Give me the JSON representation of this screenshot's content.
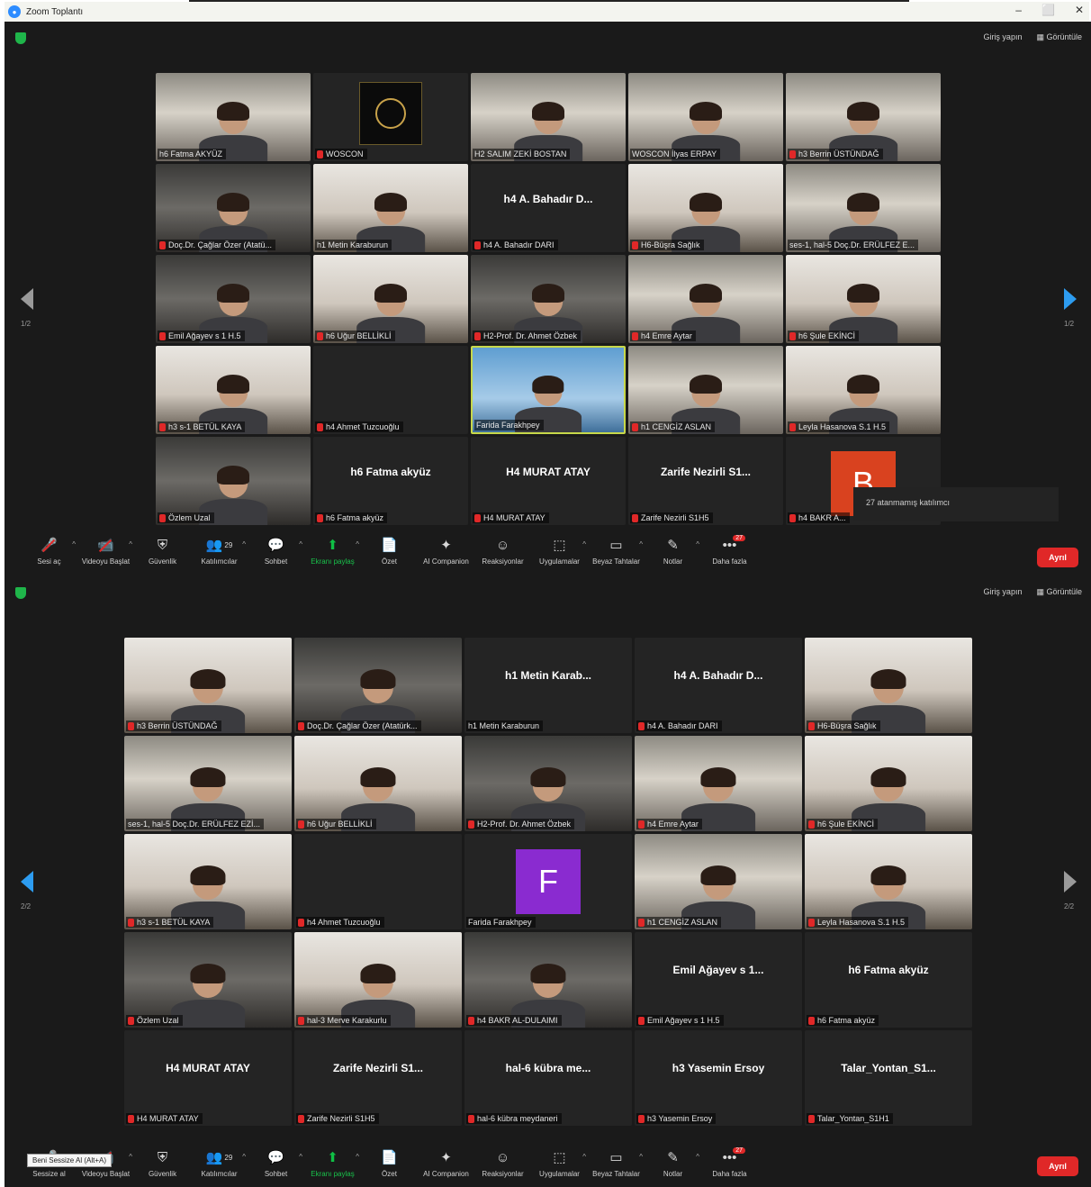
{
  "window": {
    "title": "Zoom Toplantı",
    "icon": "zoom-logo-icon",
    "controls": [
      "–",
      "⬜",
      "✕"
    ]
  },
  "view_controls": {
    "exit_full": "Giriş yapın",
    "view": "Görüntüle"
  },
  "pager": {
    "panel1": "1/2",
    "panel2": "2/2"
  },
  "panel1_tiles": [
    {
      "label": "h6 Fatma AKYÜZ",
      "kind": "video",
      "muted": false
    },
    {
      "label": "WOSCON",
      "kind": "logo",
      "muted": true
    },
    {
      "label": "H2 SALIM ZEKİ BOSTAN",
      "kind": "video",
      "muted": false
    },
    {
      "label": "WOSCON İlyas ERPAY",
      "kind": "video",
      "muted": false
    },
    {
      "label": "h3 Berrin ÜSTÜNDAĞ",
      "kind": "video",
      "muted": true
    },
    {
      "label": "Doç.Dr. Çağlar Özer (Atatü...",
      "kind": "video3",
      "muted": true
    },
    {
      "label": "h1 Metin Karaburun",
      "kind": "video2",
      "muted": false
    },
    {
      "label": "h4 A. Bahadır DARI",
      "kind": "name",
      "center": "h4 A. Bahadır D...",
      "muted": true
    },
    {
      "label": "H6-Büşra Sağlık",
      "kind": "video2",
      "muted": true
    },
    {
      "label": "ses-1, hal-5 Doç.Dr. ERÜLFEZ E...",
      "kind": "video",
      "muted": false
    },
    {
      "label": "Emil Ağayev s 1 H.5",
      "kind": "video3",
      "muted": true
    },
    {
      "label": "h6 Uğur BELLİKLİ",
      "kind": "video2",
      "muted": true
    },
    {
      "label": "H2-Prof. Dr. Ahmet Özbek",
      "kind": "video3",
      "muted": true
    },
    {
      "label": "h4 Emre Aytar",
      "kind": "video",
      "muted": true
    },
    {
      "label": "h6 Şule EKİNCİ",
      "kind": "video2",
      "muted": true
    },
    {
      "label": "h3 s-1 BETÜL KAYA",
      "kind": "video2",
      "muted": true
    },
    {
      "label": "h4 Ahmet Tuzcuoğlu",
      "kind": "blank",
      "muted": true
    },
    {
      "label": "Farida Farakhpey",
      "kind": "map",
      "muted": false
    },
    {
      "label": "h1 CENGİZ ASLAN",
      "kind": "video",
      "muted": true
    },
    {
      "label": "Leyla Hasanova S.1 H.5",
      "kind": "video2",
      "muted": true
    },
    {
      "label": "Özlem Uzal",
      "kind": "video3",
      "muted": true
    },
    {
      "label": "h6 Fatma akyüz",
      "kind": "name",
      "center": "h6 Fatma akyüz",
      "muted": true
    },
    {
      "label": "H4 MURAT ATAY",
      "kind": "name",
      "center": "H4 MURAT ATAY",
      "muted": true
    },
    {
      "label": "Zarife Nezirli S1H5",
      "kind": "name",
      "center": "Zarife Nezirli S1...",
      "muted": true
    },
    {
      "label": "h4 BAKR A...",
      "kind": "avatar",
      "letter": "B",
      "color": "#d9421f",
      "muted": true
    }
  ],
  "panel2_tiles": [
    {
      "label": "h3 Berrin ÜSTÜNDAĞ",
      "kind": "video2",
      "muted": true
    },
    {
      "label": "Doç.Dr. Çağlar Özer (Atatürk...",
      "kind": "video3",
      "muted": true
    },
    {
      "label": "h1 Metin Karaburun",
      "kind": "name",
      "center": "h1 Metin Karab...",
      "muted": false
    },
    {
      "label": "h4 A. Bahadır DARI",
      "kind": "name",
      "center": "h4 A. Bahadır D...",
      "muted": true
    },
    {
      "label": "H6-Büşra Sağlık",
      "kind": "video2",
      "muted": true
    },
    {
      "label": "ses-1, hal-5 Doç.Dr. ERÜLFEZ EZİ...",
      "kind": "video",
      "muted": false
    },
    {
      "label": "h6 Uğur BELLİKLİ",
      "kind": "video2",
      "muted": true
    },
    {
      "label": "H2-Prof. Dr. Ahmet Özbek",
      "kind": "video3",
      "muted": true
    },
    {
      "label": "h4 Emre Aytar",
      "kind": "video",
      "muted": true
    },
    {
      "label": "h6 Şule EKİNCİ",
      "kind": "video2",
      "muted": true
    },
    {
      "label": "h3 s-1 BETÜL KAYA",
      "kind": "video2",
      "muted": true
    },
    {
      "label": "h4 Ahmet Tuzcuoğlu",
      "kind": "blank",
      "muted": true
    },
    {
      "label": "Farida Farakhpey",
      "kind": "avatar",
      "letter": "F",
      "color": "#8a2bd0",
      "muted": false
    },
    {
      "label": "h1 CENGİZ ASLAN",
      "kind": "video",
      "muted": true
    },
    {
      "label": "Leyla Hasanova S.1 H.5",
      "kind": "video2",
      "muted": true
    },
    {
      "label": "Özlem Uzal",
      "kind": "video3",
      "muted": true
    },
    {
      "label": "hal-3 Merve Karakurlu",
      "kind": "video2",
      "muted": true
    },
    {
      "label": "h4 BAKR AL-DULAIMI",
      "kind": "video3",
      "muted": true
    },
    {
      "label": "Emil Ağayev s 1 H.5",
      "kind": "name",
      "center": "Emil Ağayev s 1...",
      "muted": true
    },
    {
      "label": "h6 Fatma akyüz",
      "kind": "name",
      "center": "h6 Fatma akyüz",
      "muted": true
    },
    {
      "label": "H4 MURAT ATAY",
      "kind": "name",
      "center": "H4 MURAT ATAY",
      "muted": true
    },
    {
      "label": "Zarife Nezirli S1H5",
      "kind": "name",
      "center": "Zarife Nezirli S1...",
      "muted": true
    },
    {
      "label": "hal-6 kübra meydaneri",
      "kind": "name",
      "center": "hal-6 kübra me...",
      "muted": true
    },
    {
      "label": "h3 Yasemin Ersoy",
      "kind": "name",
      "center": "h3 Yasemin Ersoy",
      "muted": true
    },
    {
      "label": "Talar_Yontan_S1H1",
      "kind": "name",
      "center": "Talar_Yontan_S1...",
      "muted": true
    }
  ],
  "popup": {
    "text": "27 atanmamış katılımcı"
  },
  "toolbar1": [
    {
      "id": "mic",
      "icon": "🎤",
      "label": "Sesi aç",
      "caret": true,
      "strike": true
    },
    {
      "id": "video",
      "icon": "📹",
      "label": "Videoyu Başlat",
      "caret": true,
      "strike": true
    },
    {
      "id": "security",
      "icon": "⛨",
      "label": "Güvenlik"
    },
    {
      "id": "participants",
      "icon": "👥",
      "count": "29",
      "label": "Katılımcılar",
      "caret": true
    },
    {
      "id": "chat",
      "icon": "💬",
      "label": "Sohbet",
      "caret": true
    },
    {
      "id": "share",
      "icon": "⬆",
      "label": "Ekranı paylaş",
      "caret": true
    },
    {
      "id": "summary",
      "icon": "📄",
      "label": "Özet"
    },
    {
      "id": "ai",
      "icon": "✦",
      "label": "AI Companion"
    },
    {
      "id": "reactions",
      "icon": "☺",
      "label": "Reaksiyonlar"
    },
    {
      "id": "apps",
      "icon": "⬚",
      "label": "Uygulamalar",
      "caret": true
    },
    {
      "id": "whiteboard",
      "icon": "▭",
      "label": "Beyaz Tahtalar",
      "caret": true
    },
    {
      "id": "notes",
      "icon": "✎",
      "label": "Notlar",
      "caret": true
    },
    {
      "id": "more",
      "icon": "•••",
      "label": "Daha fazla",
      "badge": "27"
    }
  ],
  "toolbar2": [
    {
      "id": "mic",
      "icon": "🎤",
      "label": "Sessize al",
      "caret": true
    },
    {
      "id": "video",
      "icon": "📹",
      "label": "Videoyu Başlat",
      "caret": true,
      "strike": true
    },
    {
      "id": "security",
      "icon": "⛨",
      "label": "Güvenlik"
    },
    {
      "id": "participants",
      "icon": "👥",
      "count": "29",
      "label": "Katılımcılar",
      "caret": true
    },
    {
      "id": "chat",
      "icon": "💬",
      "label": "Sohbet",
      "caret": true
    },
    {
      "id": "share",
      "icon": "⬆",
      "label": "Ekranı paylaş",
      "caret": true
    },
    {
      "id": "summary",
      "icon": "📄",
      "label": "Özet"
    },
    {
      "id": "ai",
      "icon": "✦",
      "label": "AI Companion"
    },
    {
      "id": "reactions",
      "icon": "☺",
      "label": "Reaksiyonlar"
    },
    {
      "id": "apps",
      "icon": "⬚",
      "label": "Uygulamalar",
      "caret": true
    },
    {
      "id": "whiteboard",
      "icon": "▭",
      "label": "Beyaz Tahtalar",
      "caret": true
    },
    {
      "id": "notes",
      "icon": "✎",
      "label": "Notlar",
      "caret": true
    },
    {
      "id": "more",
      "icon": "•••",
      "label": "Daha fazla",
      "badge": "27"
    }
  ],
  "leave_label": "Ayrıl",
  "tooltip": "Beni Sessize Al (Alt+A)"
}
